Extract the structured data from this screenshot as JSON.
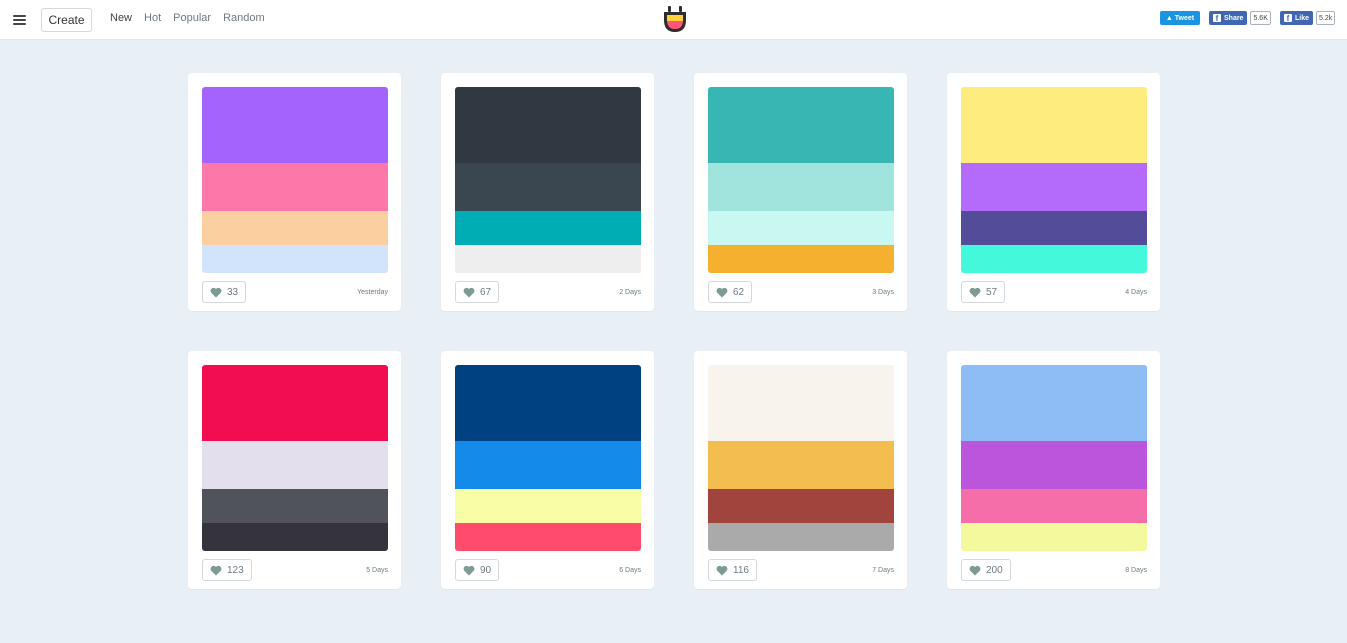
{
  "header": {
    "create_label": "Create",
    "nav": [
      "New",
      "Hot",
      "Popular",
      "Random"
    ],
    "tweet_label": "Tweet",
    "share_label": "Share",
    "share_count": "5.6K",
    "like_label": "Like",
    "like_count": "5.2k"
  },
  "palettes": [
    {
      "colors": [
        "#a463fd",
        "#fd77a9",
        "#fccfa0",
        "#d2e4fb"
      ],
      "likes": "33",
      "date": "Yesterday"
    },
    {
      "colors": [
        "#303841",
        "#3a4750",
        "#00adb5",
        "#eeeeee"
      ],
      "likes": "67",
      "date": "2 Days"
    },
    {
      "colors": [
        "#38b6b4",
        "#a1e3dd",
        "#c9f7f2",
        "#f5b02f"
      ],
      "likes": "62",
      "date": "3 Days"
    },
    {
      "colors": [
        "#ffec7f",
        "#b46bfb",
        "#534c99",
        "#44f8dc"
      ],
      "likes": "57",
      "date": "4 Days"
    },
    {
      "colors": [
        "#f10d50",
        "#e4dfed",
        "#50545a",
        "#35343c"
      ],
      "likes": "123",
      "date": "5 Days"
    },
    {
      "colors": [
        "#004182",
        "#148aea",
        "#f9fda5",
        "#ff4c6c"
      ],
      "likes": "90",
      "date": "6 Days"
    },
    {
      "colors": [
        "#f8f4ed",
        "#f4bd50",
        "#a0443d",
        "#aaaaaa"
      ],
      "likes": "116",
      "date": "7 Days"
    },
    {
      "colors": [
        "#8dbdf4",
        "#ba55dc",
        "#f56da9",
        "#f4f99e"
      ],
      "likes": "200",
      "date": "8 Days"
    }
  ]
}
